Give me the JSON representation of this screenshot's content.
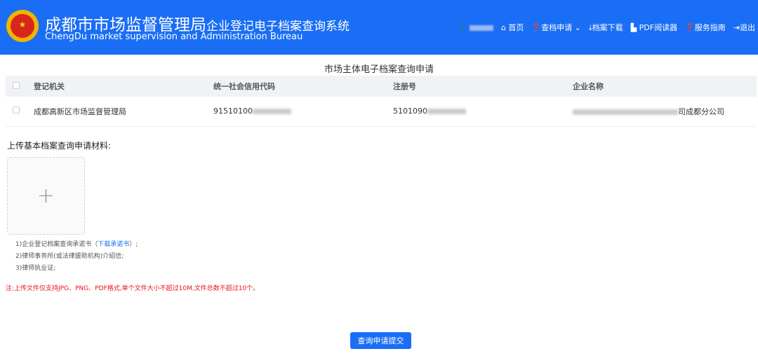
{
  "header": {
    "title": "成都市市场监督管理局",
    "subtitle": "企业登记电子档案查询系统",
    "english": "ChengDu market supervision and Administration Bureau",
    "nav": {
      "home": "首页",
      "apply": "查档申请",
      "download": "档案下载",
      "pdf": "PDF阅读器",
      "guide": "服务指南",
      "logout": "退出"
    }
  },
  "page_title": "市场主体电子档案查询申请",
  "table": {
    "headers": [
      "登记机关",
      "统一社会信用代码",
      "注册号",
      "企业名称"
    ],
    "rows": [
      {
        "authority": "成都高新区市场监督管理局",
        "credit_code": "91510100",
        "reg_no": "5101090",
        "name": "司成都分公司"
      }
    ]
  },
  "upload": {
    "label": "上传基本档案查询申请材料:",
    "plus": "+",
    "notes": {
      "n1": "1)企业登记档案查询承诺书（",
      "n1_link": "下载承诺书",
      "n1_end": "）;",
      "n2": "2)律师事务所(或法律援助机构)介绍信;",
      "n3": "3)律师执业证;"
    },
    "warning": "注:上传文件仅支持JPG、PNG、PDF格式,单个文件大小不超过10M,文件总数不超过10个。"
  },
  "submit": "查询申请提交"
}
